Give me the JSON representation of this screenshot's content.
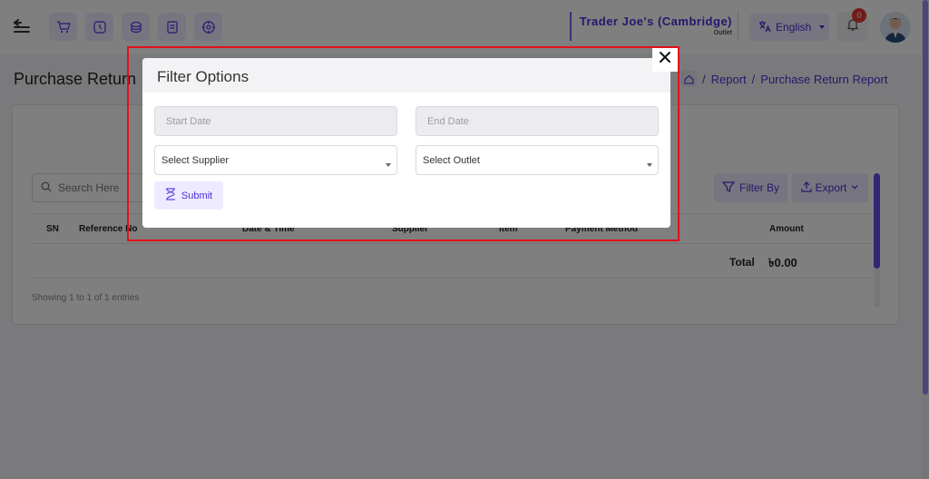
{
  "topbar": {
    "outlet_name": "Trader Joe's (Cambridge)",
    "outlet_label": "Outlet",
    "language": "English",
    "notification_count": "0",
    "nav_icons": [
      "cart-icon",
      "clock-icon",
      "coins-icon",
      "document-icon",
      "target-icon"
    ]
  },
  "page": {
    "title": "Purchase Return",
    "breadcrumb": [
      "Report",
      "Purchase Return Report"
    ],
    "separator": "/"
  },
  "toolbar": {
    "search_placeholder": "Search Here",
    "filter_label": "Filter By",
    "export_label": "Export"
  },
  "table": {
    "columns": [
      "SN",
      "Reference No",
      "Date & Time",
      "Supplier",
      "Item",
      "Payment Method",
      "Amount"
    ],
    "total_label": "Total",
    "total_value": "৳0.00",
    "entries_info": "Showing 1 to 1 of 1 entries"
  },
  "modal": {
    "title": "Filter Options",
    "start_date_placeholder": "Start Date",
    "end_date_placeholder": "End Date",
    "supplier_value": "Select Supplier",
    "outlet_value": "Select Outlet",
    "submit_label": "Submit"
  },
  "colors": {
    "accent": "#4b2fd8",
    "accent_bg": "#eeeaff",
    "highlight": "#e3101a"
  }
}
